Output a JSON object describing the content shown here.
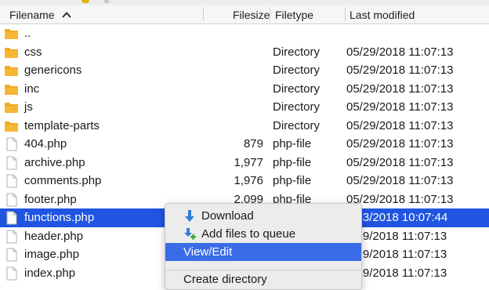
{
  "columns": {
    "filename": "Filename",
    "filesize": "Filesize",
    "filetype": "Filetype",
    "last_modified": "Last modified"
  },
  "rows": [
    {
      "name": "..",
      "size": "",
      "type": "",
      "modified": "",
      "icon": "folder-icon"
    },
    {
      "name": "css",
      "size": "",
      "type": "Directory",
      "modified": "05/29/2018 11:07:13",
      "icon": "folder-icon"
    },
    {
      "name": "genericons",
      "size": "",
      "type": "Directory",
      "modified": "05/29/2018 11:07:13",
      "icon": "folder-icon"
    },
    {
      "name": "inc",
      "size": "",
      "type": "Directory",
      "modified": "05/29/2018 11:07:13",
      "icon": "folder-icon"
    },
    {
      "name": "js",
      "size": "",
      "type": "Directory",
      "modified": "05/29/2018 11:07:13",
      "icon": "folder-icon"
    },
    {
      "name": "template-parts",
      "size": "",
      "type": "Directory",
      "modified": "05/29/2018 11:07:13",
      "icon": "folder-icon"
    },
    {
      "name": "404.php",
      "size": "879",
      "type": "php-file",
      "modified": "05/29/2018 11:07:13",
      "icon": "file-icon"
    },
    {
      "name": "archive.php",
      "size": "1,977",
      "type": "php-file",
      "modified": "05/29/2018 11:07:13",
      "icon": "file-icon"
    },
    {
      "name": "comments.php",
      "size": "1,976",
      "type": "php-file",
      "modified": "05/29/2018 11:07:13",
      "icon": "file-icon"
    },
    {
      "name": "footer.php",
      "size": "2,099",
      "type": "php-file",
      "modified": "05/29/2018 11:07:13",
      "icon": "file-icon"
    },
    {
      "name": "functions.php",
      "size": "",
      "type": "",
      "modified": "7/13/2018 10:07:44",
      "icon": "file-icon",
      "selected": true
    },
    {
      "name": "header.php",
      "size": "",
      "type": "",
      "modified": "5/29/2018 11:07:13",
      "icon": "file-icon"
    },
    {
      "name": "image.php",
      "size": "",
      "type": "",
      "modified": "5/29/2018 11:07:13",
      "icon": "file-icon"
    },
    {
      "name": "index.php",
      "size": "",
      "type": "",
      "modified": "5/29/2018 11:07:13",
      "icon": "file-icon"
    }
  ],
  "context_menu": {
    "download": "Download",
    "add_to_queue": "Add files to queue",
    "view_edit": "View/Edit",
    "create_directory": "Create directory"
  },
  "colors": {
    "selection": "#1f55e0",
    "menu_highlight": "#3b6ce8",
    "folder": "#f2a922",
    "download_arrow": "#2f7fd8",
    "queue_plus": "#3aa640"
  }
}
